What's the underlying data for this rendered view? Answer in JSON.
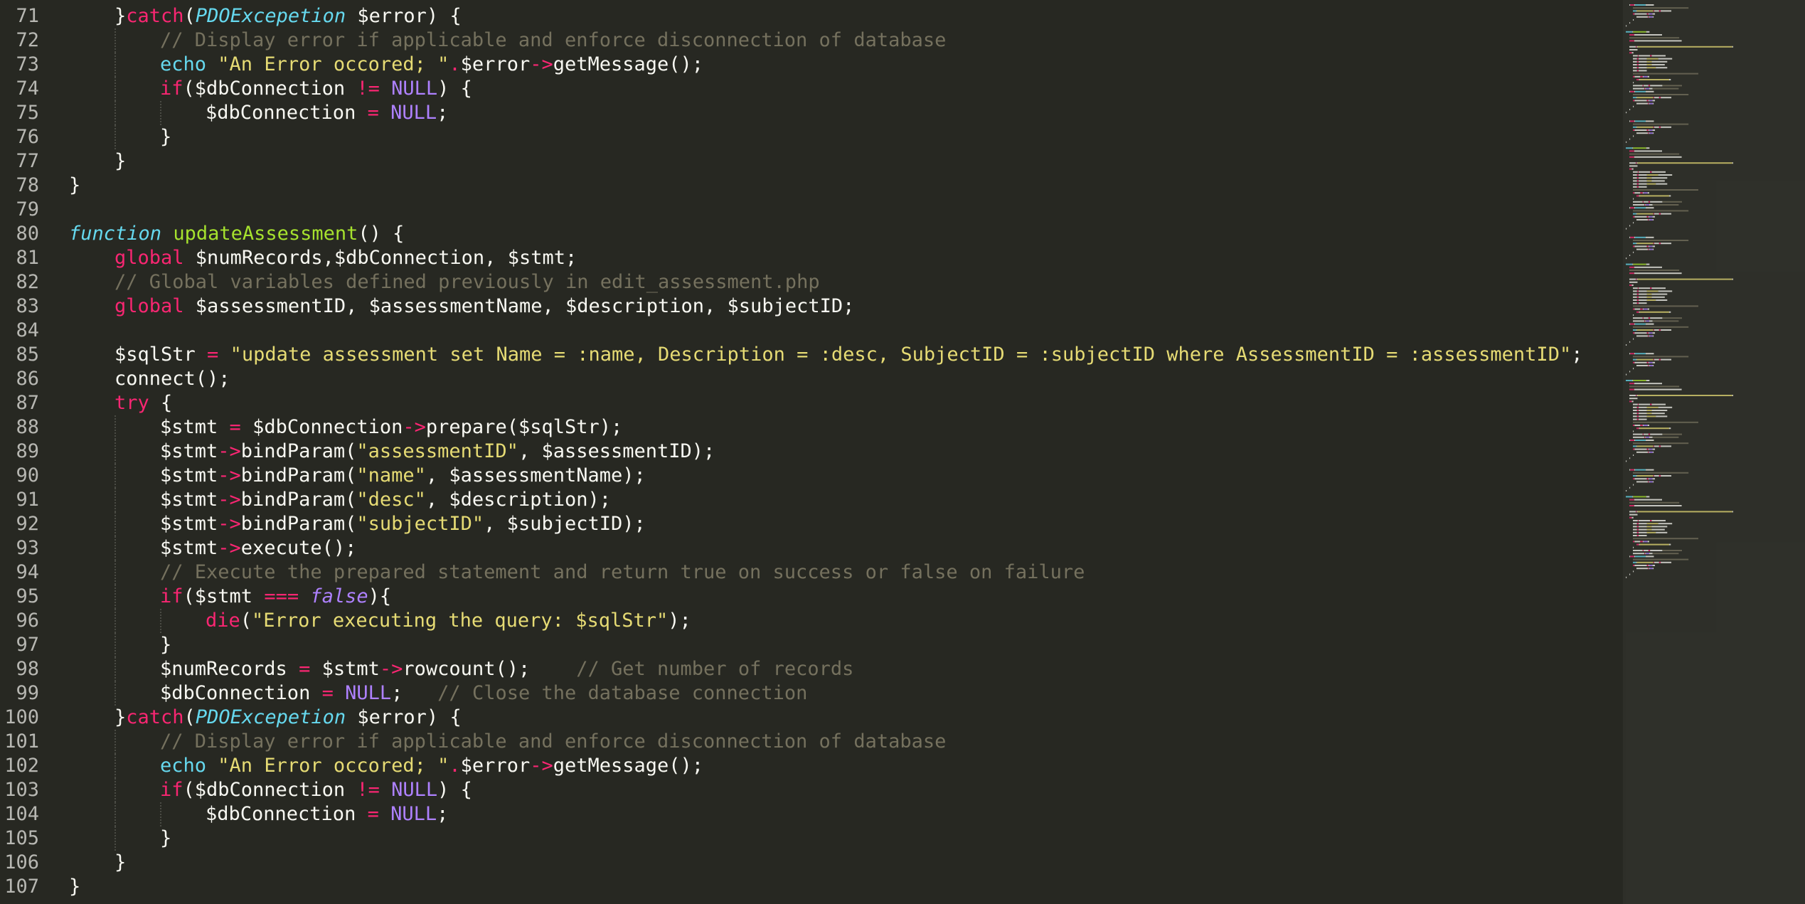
{
  "editor": {
    "theme_colors": {
      "background": "#272822",
      "foreground": "#F8F8F2",
      "keyword": "#F92672",
      "string": "#E6DB74",
      "function_name": "#A6E22E",
      "comment": "#75715E",
      "constant": "#AE81FF",
      "class_name": "#66D9EF",
      "line_number": "#B7B7B2"
    },
    "lines": [
      {
        "n": "71",
        "indent": 1,
        "tokens": [
          [
            "}",
            "plain"
          ],
          [
            "catch",
            "kw"
          ],
          [
            "(",
            "plain"
          ],
          [
            "PDOExcepetion",
            "cls"
          ],
          [
            " $error) {",
            "plain"
          ]
        ]
      },
      {
        "n": "72",
        "indent": 2,
        "tokens": [
          [
            "// Display error if applicable and enforce disconnection of database",
            "cm"
          ]
        ]
      },
      {
        "n": "73",
        "indent": 2,
        "tokens": [
          [
            "echo",
            "sfn"
          ],
          [
            " ",
            "plain"
          ],
          [
            "\"An Error occored; \"",
            "str"
          ],
          [
            ".",
            "op"
          ],
          [
            "$error",
            "plain"
          ],
          [
            "->",
            "op"
          ],
          [
            "getMessage();",
            "plain"
          ]
        ]
      },
      {
        "n": "74",
        "indent": 2,
        "tokens": [
          [
            "if",
            "kw"
          ],
          [
            "($dbConnection ",
            "plain"
          ],
          [
            "!=",
            "op"
          ],
          [
            " ",
            "plain"
          ],
          [
            "NULL",
            "const"
          ],
          [
            ") {",
            "plain"
          ]
        ]
      },
      {
        "n": "75",
        "indent": 3,
        "tokens": [
          [
            "$dbConnection ",
            "plain"
          ],
          [
            "=",
            "op"
          ],
          [
            " ",
            "plain"
          ],
          [
            "NULL",
            "const"
          ],
          [
            ";",
            "plain"
          ]
        ]
      },
      {
        "n": "76",
        "indent": 2,
        "tokens": [
          [
            "}",
            "plain"
          ]
        ]
      },
      {
        "n": "77",
        "indent": 1,
        "tokens": [
          [
            "}",
            "plain"
          ]
        ]
      },
      {
        "n": "78",
        "indent": 0,
        "tokens": [
          [
            "}",
            "plain"
          ]
        ]
      },
      {
        "n": "79",
        "indent": 0,
        "tokens": []
      },
      {
        "n": "80",
        "indent": 0,
        "tokens": [
          [
            "function",
            "store"
          ],
          [
            " ",
            "plain"
          ],
          [
            "updateAssessment",
            "fn"
          ],
          [
            "() {",
            "plain"
          ]
        ]
      },
      {
        "n": "81",
        "indent": 1,
        "tokens": [
          [
            "global",
            "kw"
          ],
          [
            " $numRecords,$dbConnection, $stmt;",
            "plain"
          ]
        ]
      },
      {
        "n": "82",
        "indent": 1,
        "tokens": [
          [
            "// Global variables defined previously in edit_assessment.php",
            "cm"
          ]
        ]
      },
      {
        "n": "83",
        "indent": 1,
        "tokens": [
          [
            "global",
            "kw"
          ],
          [
            " $assessmentID, $assessmentName, $description, $subjectID;",
            "plain"
          ]
        ]
      },
      {
        "n": "84",
        "indent": 0,
        "tokens": []
      },
      {
        "n": "85",
        "indent": 1,
        "tokens": [
          [
            "$sqlStr ",
            "plain"
          ],
          [
            "=",
            "op"
          ],
          [
            " ",
            "plain"
          ],
          [
            "\"update assessment set Name = :name, Description = :desc, SubjectID = :subjectID where AssessmentID = :assessmentID\"",
            "str"
          ],
          [
            ";",
            "plain"
          ]
        ]
      },
      {
        "n": "86",
        "indent": 1,
        "tokens": [
          [
            "connect();",
            "plain"
          ]
        ]
      },
      {
        "n": "87",
        "indent": 1,
        "tokens": [
          [
            "try",
            "kw"
          ],
          [
            " {",
            "plain"
          ]
        ]
      },
      {
        "n": "88",
        "indent": 2,
        "tokens": [
          [
            "$stmt ",
            "plain"
          ],
          [
            "=",
            "op"
          ],
          [
            " $dbConnection",
            "plain"
          ],
          [
            "->",
            "op"
          ],
          [
            "prepare($sqlStr);",
            "plain"
          ]
        ]
      },
      {
        "n": "89",
        "indent": 2,
        "tokens": [
          [
            "$stmt",
            "plain"
          ],
          [
            "->",
            "op"
          ],
          [
            "bindParam(",
            "plain"
          ],
          [
            "\"assessmentID\"",
            "str"
          ],
          [
            ", $assessmentID);",
            "plain"
          ]
        ]
      },
      {
        "n": "90",
        "indent": 2,
        "tokens": [
          [
            "$stmt",
            "plain"
          ],
          [
            "->",
            "op"
          ],
          [
            "bindParam(",
            "plain"
          ],
          [
            "\"name\"",
            "str"
          ],
          [
            ", $assessmentName);",
            "plain"
          ]
        ]
      },
      {
        "n": "91",
        "indent": 2,
        "tokens": [
          [
            "$stmt",
            "plain"
          ],
          [
            "->",
            "op"
          ],
          [
            "bindParam(",
            "plain"
          ],
          [
            "\"desc\"",
            "str"
          ],
          [
            ", $description);",
            "plain"
          ]
        ]
      },
      {
        "n": "92",
        "indent": 2,
        "tokens": [
          [
            "$stmt",
            "plain"
          ],
          [
            "->",
            "op"
          ],
          [
            "bindParam(",
            "plain"
          ],
          [
            "\"subjectID\"",
            "str"
          ],
          [
            ", $subjectID);",
            "plain"
          ]
        ]
      },
      {
        "n": "93",
        "indent": 2,
        "tokens": [
          [
            "$stmt",
            "plain"
          ],
          [
            "->",
            "op"
          ],
          [
            "execute();",
            "plain"
          ]
        ]
      },
      {
        "n": "94",
        "indent": 2,
        "tokens": [
          [
            "// Execute the prepared statement and return true on success or false on failure",
            "cm"
          ]
        ]
      },
      {
        "n": "95",
        "indent": 2,
        "tokens": [
          [
            "if",
            "kw"
          ],
          [
            "($stmt ",
            "plain"
          ],
          [
            "===",
            "op"
          ],
          [
            " ",
            "plain"
          ],
          [
            "false",
            "kwi"
          ],
          [
            "){",
            "plain"
          ]
        ]
      },
      {
        "n": "96",
        "indent": 3,
        "tokens": [
          [
            "die",
            "kw"
          ],
          [
            "(",
            "plain"
          ],
          [
            "\"Error executing the query: $sqlStr\"",
            "str"
          ],
          [
            ");",
            "plain"
          ]
        ]
      },
      {
        "n": "97",
        "indent": 2,
        "tokens": [
          [
            "}",
            "plain"
          ]
        ]
      },
      {
        "n": "98",
        "indent": 2,
        "tokens": [
          [
            "$numRecords ",
            "plain"
          ],
          [
            "=",
            "op"
          ],
          [
            " $stmt",
            "plain"
          ],
          [
            "->",
            "op"
          ],
          [
            "rowcount();    ",
            "plain"
          ],
          [
            "// Get number of records",
            "cm"
          ]
        ]
      },
      {
        "n": "99",
        "indent": 2,
        "tokens": [
          [
            "$dbConnection ",
            "plain"
          ],
          [
            "=",
            "op"
          ],
          [
            " ",
            "plain"
          ],
          [
            "NULL",
            "const"
          ],
          [
            ";   ",
            "plain"
          ],
          [
            "// Close the database connection",
            "cm"
          ]
        ]
      },
      {
        "n": "100",
        "indent": 1,
        "tokens": [
          [
            "}",
            "plain"
          ],
          [
            "catch",
            "kw"
          ],
          [
            "(",
            "plain"
          ],
          [
            "PDOExcepetion",
            "cls"
          ],
          [
            " $error) {",
            "plain"
          ]
        ]
      },
      {
        "n": "101",
        "indent": 2,
        "tokens": [
          [
            "// Display error if applicable and enforce disconnection of database",
            "cm"
          ]
        ]
      },
      {
        "n": "102",
        "indent": 2,
        "tokens": [
          [
            "echo",
            "sfn"
          ],
          [
            " ",
            "plain"
          ],
          [
            "\"An Error occored; \"",
            "str"
          ],
          [
            ".",
            "op"
          ],
          [
            "$error",
            "plain"
          ],
          [
            "->",
            "op"
          ],
          [
            "getMessage();",
            "plain"
          ]
        ]
      },
      {
        "n": "103",
        "indent": 2,
        "tokens": [
          [
            "if",
            "kw"
          ],
          [
            "($dbConnection ",
            "plain"
          ],
          [
            "!=",
            "op"
          ],
          [
            " ",
            "plain"
          ],
          [
            "NULL",
            "const"
          ],
          [
            ") {",
            "plain"
          ]
        ]
      },
      {
        "n": "104",
        "indent": 3,
        "tokens": [
          [
            "$dbConnection ",
            "plain"
          ],
          [
            "=",
            "op"
          ],
          [
            " ",
            "plain"
          ],
          [
            "NULL",
            "const"
          ],
          [
            ";",
            "plain"
          ]
        ]
      },
      {
        "n": "105",
        "indent": 2,
        "tokens": [
          [
            "}",
            "plain"
          ]
        ]
      },
      {
        "n": "106",
        "indent": 1,
        "tokens": [
          [
            "}",
            "plain"
          ]
        ]
      },
      {
        "n": "107",
        "indent": 0,
        "tokens": [
          [
            "}",
            "plain"
          ]
        ]
      }
    ]
  }
}
